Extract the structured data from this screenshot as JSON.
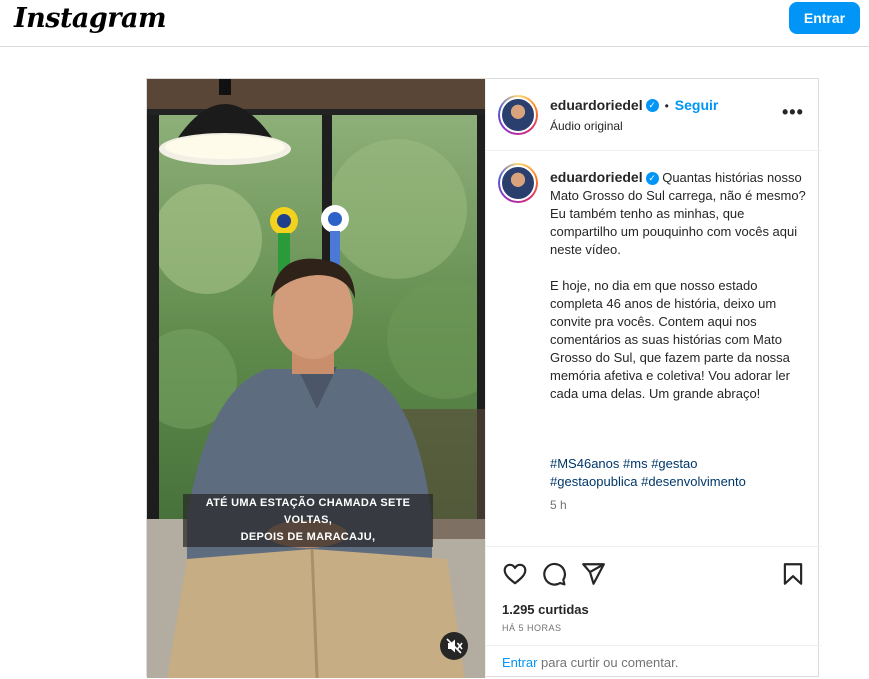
{
  "app": {
    "logo": "Instagram",
    "login_label": "Entrar"
  },
  "post": {
    "username": "eduardoriedel",
    "follow_label": "Seguir",
    "dot": "•",
    "audio": "Áudio original",
    "caption": "Quantas histórias nosso Mato Grosso do Sul carrega, não é mesmo? Eu também tenho as minhas, que compartilho um pouquinho com vocês aqui neste vídeo.\n\nE hoje, no dia em que nosso estado completa 46 anos de história, deixo um convite pra vocês. Contem aqui nos comentários as suas histórias com Mato Grosso do Sul, que fazem parte da nossa memória afetiva e coletiva! Vou adorar ler cada uma delas. Um grande abraço!",
    "hashtags": [
      "#MS46anos",
      "#ms",
      "#gestao",
      "#gestaopublica",
      "#desenvolvimento"
    ],
    "caption_time": "5 h",
    "likes": "1.295 curtidas",
    "posted_ago": "HÁ 5 HORAS",
    "footer_login": "Entrar",
    "footer_text": " para curtir ou comentar.",
    "video_subtitle_line1": "ATÉ UMA ESTAÇÃO CHAMADA SETE VOLTAS,",
    "video_subtitle_line2": "DEPOIS DE MARACAJU,"
  },
  "icons": [
    "verified-badge-icon",
    "more-options-icon",
    "heart-icon",
    "comment-icon",
    "share-icon",
    "bookmark-icon",
    "mute-icon"
  ],
  "colors": {
    "accent": "#0095f6",
    "hashtag": "#00376b",
    "muted": "#737373"
  }
}
